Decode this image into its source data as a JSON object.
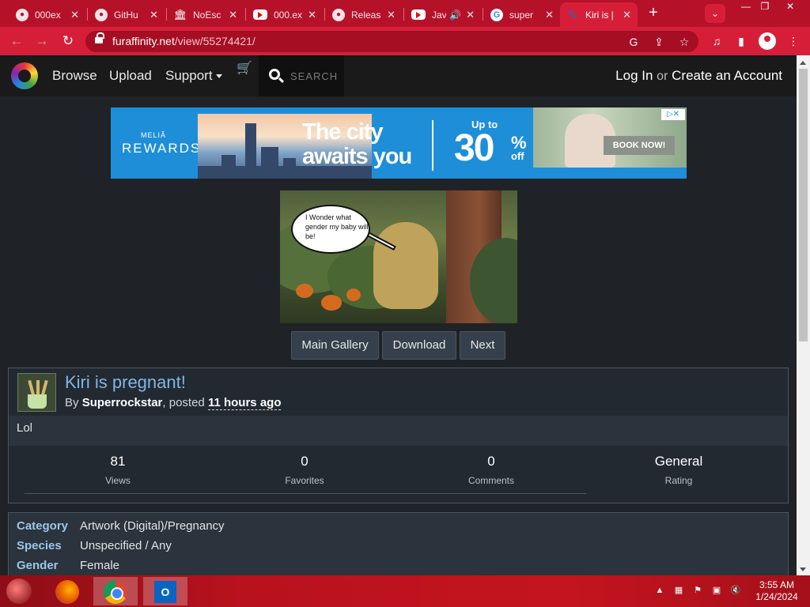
{
  "browser": {
    "tabs": [
      {
        "title": "000ex",
        "icon": "github-icon"
      },
      {
        "title": "GitHu",
        "icon": "github-icon"
      },
      {
        "title": "NoEsc",
        "icon": "bank-icon"
      },
      {
        "title": "000.ex",
        "icon": "youtube-icon"
      },
      {
        "title": "Releas",
        "icon": "github-icon"
      },
      {
        "title": "Jav",
        "icon": "youtube-icon"
      },
      {
        "title": "super",
        "icon": "google-icon"
      },
      {
        "title": "Kiri is |",
        "icon": "furaffinity-icon"
      }
    ],
    "new_tab": "+",
    "url_domain": "furaffinity.net",
    "url_path": "/view/55274421/"
  },
  "site": {
    "nav": {
      "browse": "Browse",
      "upload": "Upload",
      "support": "Support"
    },
    "search_placeholder": "SEARCH",
    "login": "Log In",
    "or": "or",
    "create_account": "Create an Account"
  },
  "ad": {
    "brand_top": "MELIÃ",
    "brand_bottom": "REWARDS",
    "headline_1": "The city",
    "headline_2": "awaits you",
    "upto": "Up to",
    "percent": "30",
    "percent_sign": "%",
    "off": "off",
    "cta": "BOOK NOW!"
  },
  "artwork": {
    "speech": "I Wonder what gender my baby will be!"
  },
  "buttons": {
    "main_gallery": "Main Gallery",
    "download": "Download",
    "next": "Next"
  },
  "submission": {
    "title": "Kiri is pregnant!",
    "by": "By",
    "author": "Superrockstar",
    "posted": ", posted",
    "when": "11 hours ago",
    "description": "Lol",
    "stats": [
      {
        "value": "81",
        "label": "Views"
      },
      {
        "value": "0",
        "label": "Favorites"
      },
      {
        "value": "0",
        "label": "Comments"
      },
      {
        "value": "General",
        "label": "Rating"
      }
    ]
  },
  "info": {
    "category_label": "Category",
    "category_value": "Artwork (Digital)/Pregnancy",
    "species_label": "Species",
    "species_value": "Unspecified / Any",
    "gender_label": "Gender",
    "gender_value": "Female"
  },
  "taskbar": {
    "time": "3:55 AM",
    "date": "1/24/2024"
  }
}
